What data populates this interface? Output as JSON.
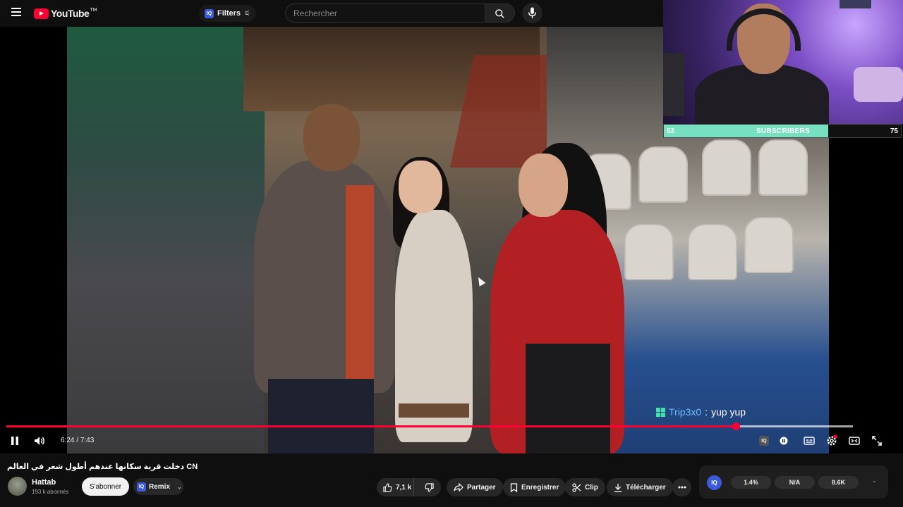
{
  "header": {
    "logo_text": "YouTube",
    "logo_tm": "TM",
    "filters_badge": "IQ",
    "filters_label": "Filters",
    "search_placeholder": "Rechercher"
  },
  "overlay": {
    "subscriber_goal": {
      "current": "52",
      "label": "SUBSCRIBERS",
      "target": "75",
      "progress_fraction": 0.693
    },
    "chat": {
      "user": "Trip3x0",
      "separator": ":",
      "message": "yup yup"
    }
  },
  "player": {
    "time_current": "6:24",
    "time_separator": "/",
    "time_total": "7:43",
    "played_fraction": 0.862,
    "buffered_fraction": 1.0
  },
  "video": {
    "title": "دخلت قرية سكانها عندهم أطول شعر في العالم CN",
    "channel_name": "Hattab",
    "subscriber_count": "193 k abonnés",
    "subscribe_label": "S'abonner",
    "remix_badge": "IQ",
    "remix_label": "Remix"
  },
  "actions": {
    "like_count": "7,1 k",
    "share_label": "Partager",
    "save_label": "Enregistrer",
    "clip_label": "Clip",
    "download_label": "Télécharger"
  },
  "stats": {
    "badge": "IQ",
    "values": [
      "1.4%",
      "N/A",
      "8.6K"
    ]
  },
  "colors": {
    "accent_red": "#ff0033",
    "goal_fill": "#76e0c0",
    "chat_user": "#6fb8ff",
    "iq_blue": "#3b5bdb"
  },
  "icons": {
    "menu": "hamburger-icon",
    "search": "search-icon",
    "mic": "mic-icon",
    "pause": "pause-icon",
    "volume": "volume-icon",
    "settings": "gear-icon",
    "fullscreen": "fullscreen-icon"
  }
}
